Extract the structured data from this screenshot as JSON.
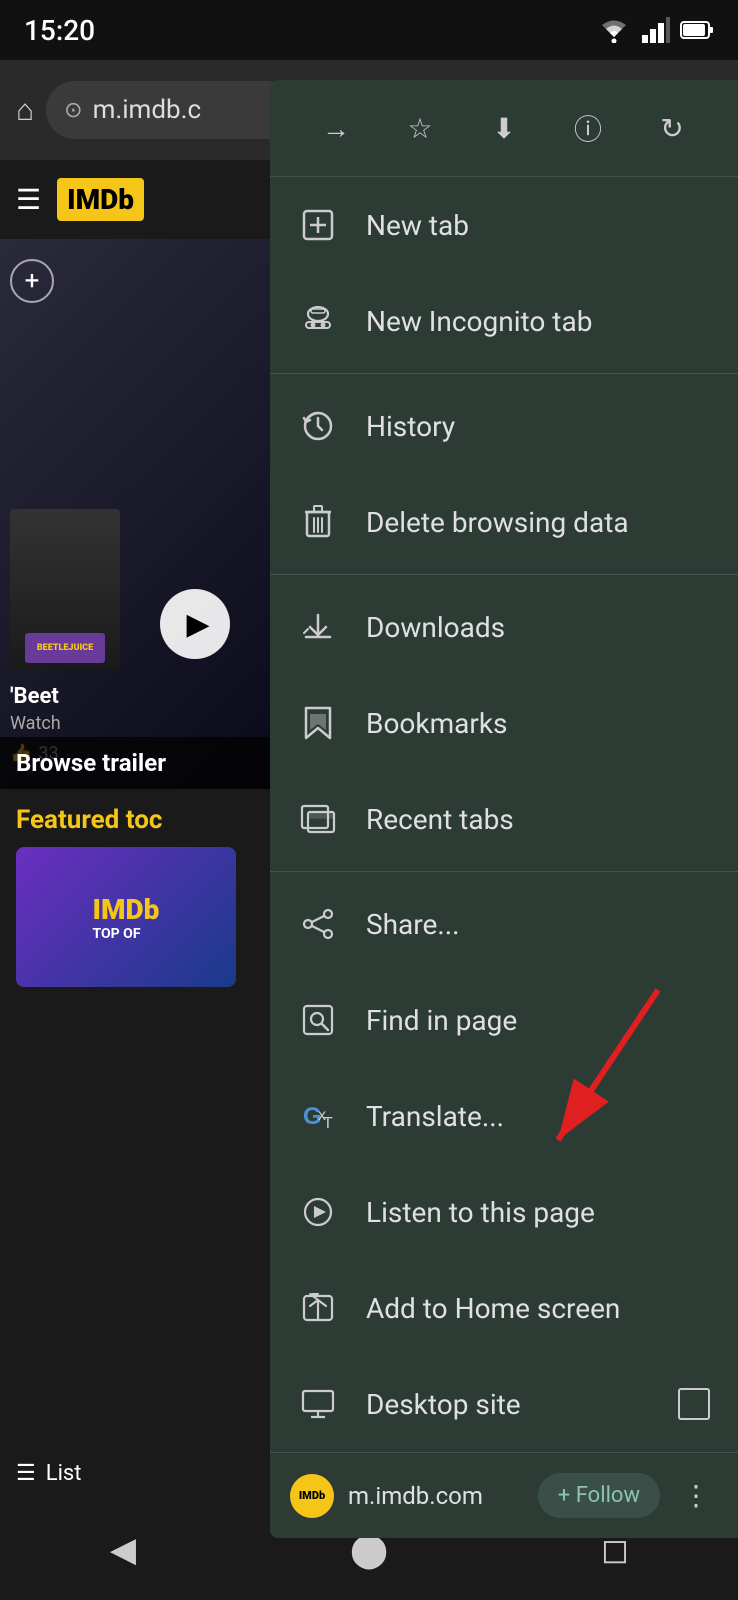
{
  "statusBar": {
    "time": "15:20"
  },
  "browserBar": {
    "urlText": "m.imdb.c"
  },
  "pageContent": {
    "imdbLogo": "IMDb",
    "movieTitle": "'Beet",
    "movieWatch": "Watch",
    "movieLikes": "33",
    "browseTrailers": "Browse trailer",
    "featuredTitle": "Featured toc",
    "imdbTopOf": "IMDb TOP OF",
    "listLabel": "List"
  },
  "dropdownMenu": {
    "toolbar": {
      "forwardIcon": "→",
      "bookmarkIcon": "☆",
      "downloadIcon": "⬇",
      "infoIcon": "ⓘ",
      "refreshIcon": "↻"
    },
    "items": [
      {
        "id": "new-tab",
        "icon": "new-tab-icon",
        "iconGlyph": "⊞",
        "label": "New tab"
      },
      {
        "id": "new-incognito",
        "icon": "incognito-icon",
        "iconGlyph": "🕵",
        "label": "New Incognito tab"
      },
      {
        "id": "history",
        "icon": "history-icon",
        "iconGlyph": "↺",
        "label": "History"
      },
      {
        "id": "delete-browsing",
        "icon": "delete-icon",
        "iconGlyph": "🗑",
        "label": "Delete browsing data"
      },
      {
        "id": "downloads",
        "icon": "downloads-icon",
        "iconGlyph": "⬇",
        "label": "Downloads"
      },
      {
        "id": "bookmarks",
        "icon": "bookmarks-icon",
        "iconGlyph": "★",
        "label": "Bookmarks"
      },
      {
        "id": "recent-tabs",
        "icon": "recent-tabs-icon",
        "iconGlyph": "⧉",
        "label": "Recent tabs"
      },
      {
        "id": "share",
        "icon": "share-icon",
        "iconGlyph": "⤴",
        "label": "Share..."
      },
      {
        "id": "find-in-page",
        "icon": "find-icon",
        "iconGlyph": "🔍",
        "label": "Find in page"
      },
      {
        "id": "translate",
        "icon": "translate-icon",
        "iconGlyph": "G",
        "label": "Translate..."
      },
      {
        "id": "listen",
        "icon": "listen-icon",
        "iconGlyph": "▶",
        "label": "Listen to this page"
      },
      {
        "id": "add-home",
        "icon": "add-home-icon",
        "iconGlyph": "⤴",
        "label": "Add to Home screen"
      },
      {
        "id": "desktop-site",
        "icon": "desktop-icon",
        "iconGlyph": "🖥",
        "label": "Desktop site"
      }
    ],
    "followBar": {
      "siteIconText": "IMDb",
      "domain": "m.imdb.com",
      "followLabel": "+ Follow",
      "moreIcon": "⋮"
    }
  },
  "navBar": {
    "backIcon": "◀",
    "homeIcon": "⬤",
    "squareIcon": "◻"
  }
}
